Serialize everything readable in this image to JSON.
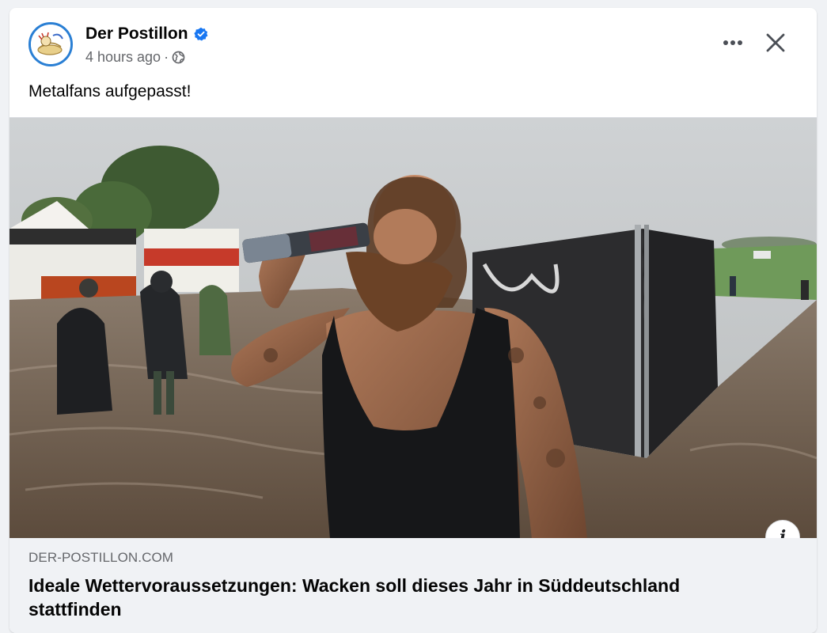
{
  "post": {
    "page_name": "Der Postillon",
    "verified_icon": "verified-badge-icon",
    "timestamp": "4 hours ago",
    "separator": "·",
    "audience_icon": "globe-icon",
    "text": "Metalfans aufgepasst!",
    "more_icon": "more-options-icon",
    "close_icon": "close-icon"
  },
  "photo": {
    "info_glyph": "i"
  },
  "link_preview": {
    "domain": "DER-POSTILLON.COM",
    "title": "Ideale Wettervoraussetzungen: Wacken soll dieses Jahr in Süddeutschland stattfinden"
  },
  "colors": {
    "verified_blue": "#1877f2",
    "secondary_text": "#65676b",
    "primary_text": "#050505",
    "preview_bg": "#f0f2f5"
  }
}
